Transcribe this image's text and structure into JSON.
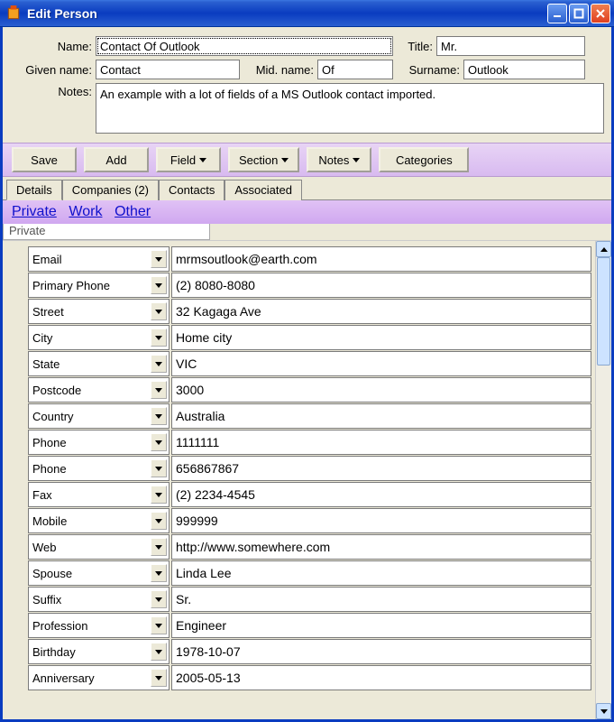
{
  "window": {
    "title": "Edit Person"
  },
  "form": {
    "name_label": "Name:",
    "name_value": "Contact Of Outlook",
    "title_label": "Title:",
    "title_value": "Mr.",
    "given_label": "Given name:",
    "given_value": "Contact",
    "mid_label": "Mid. name:",
    "mid_value": "Of",
    "surname_label": "Surname:",
    "surname_value": "Outlook",
    "notes_label": "Notes:",
    "notes_value": "An example with a lot of fields of a MS Outlook contact imported."
  },
  "toolbar": {
    "save": "Save",
    "add": "Add",
    "field": "Field",
    "section": "Section",
    "notes": "Notes",
    "categories": "Categories"
  },
  "tabs": {
    "details": "Details",
    "companies": "Companies (2)",
    "contacts": "Contacts",
    "associated": "Associated"
  },
  "subnav": {
    "private": "Private",
    "work": "Work",
    "other": "Other"
  },
  "section_label": "Private",
  "rows": [
    {
      "label": "Email",
      "value": "mrmsoutlook@earth.com"
    },
    {
      "label": "Primary Phone",
      "value": "(2) 8080-8080"
    },
    {
      "label": "Street",
      "value": "32 Kagaga Ave"
    },
    {
      "label": "City",
      "value": "Home city"
    },
    {
      "label": "State",
      "value": "VIC"
    },
    {
      "label": "Postcode",
      "value": "3000"
    },
    {
      "label": "Country",
      "value": "Australia"
    },
    {
      "label": "Phone",
      "value": "1111111"
    },
    {
      "label": "Phone",
      "value": "656867867"
    },
    {
      "label": "Fax",
      "value": "(2) 2234-4545"
    },
    {
      "label": "Mobile",
      "value": "999999"
    },
    {
      "label": "Web",
      "value": "http://www.somewhere.com"
    },
    {
      "label": "Spouse",
      "value": "Linda Lee"
    },
    {
      "label": "Suffix",
      "value": "Sr."
    },
    {
      "label": "Profession",
      "value": "Engineer"
    },
    {
      "label": "Birthday",
      "value": "1978-10-07"
    },
    {
      "label": "Anniversary",
      "value": "2005-05-13"
    }
  ]
}
